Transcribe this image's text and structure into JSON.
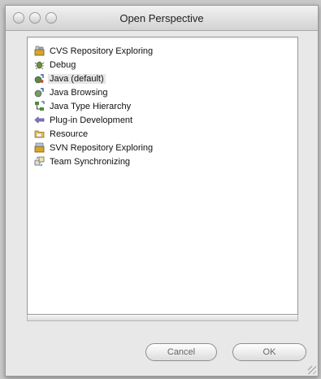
{
  "window": {
    "title": "Open Perspective"
  },
  "perspectives": [
    {
      "label": "CVS Repository Exploring",
      "icon": "cvs-repository-icon",
      "selected": false
    },
    {
      "label": "Debug",
      "icon": "debug-bug-icon",
      "selected": false
    },
    {
      "label": "Java (default)",
      "icon": "java-perspective-icon",
      "selected": true
    },
    {
      "label": "Java Browsing",
      "icon": "java-browsing-icon",
      "selected": false
    },
    {
      "label": "Java Type Hierarchy",
      "icon": "type-hierarchy-icon",
      "selected": false
    },
    {
      "label": "Plug-in Development",
      "icon": "plugin-icon",
      "selected": false
    },
    {
      "label": "Resource",
      "icon": "resource-folder-icon",
      "selected": false
    },
    {
      "label": "SVN Repository Exploring",
      "icon": "svn-repository-icon",
      "selected": false
    },
    {
      "label": "Team Synchronizing",
      "icon": "team-sync-icon",
      "selected": false
    }
  ],
  "buttons": {
    "cancel_label": "Cancel",
    "ok_label": "OK"
  }
}
